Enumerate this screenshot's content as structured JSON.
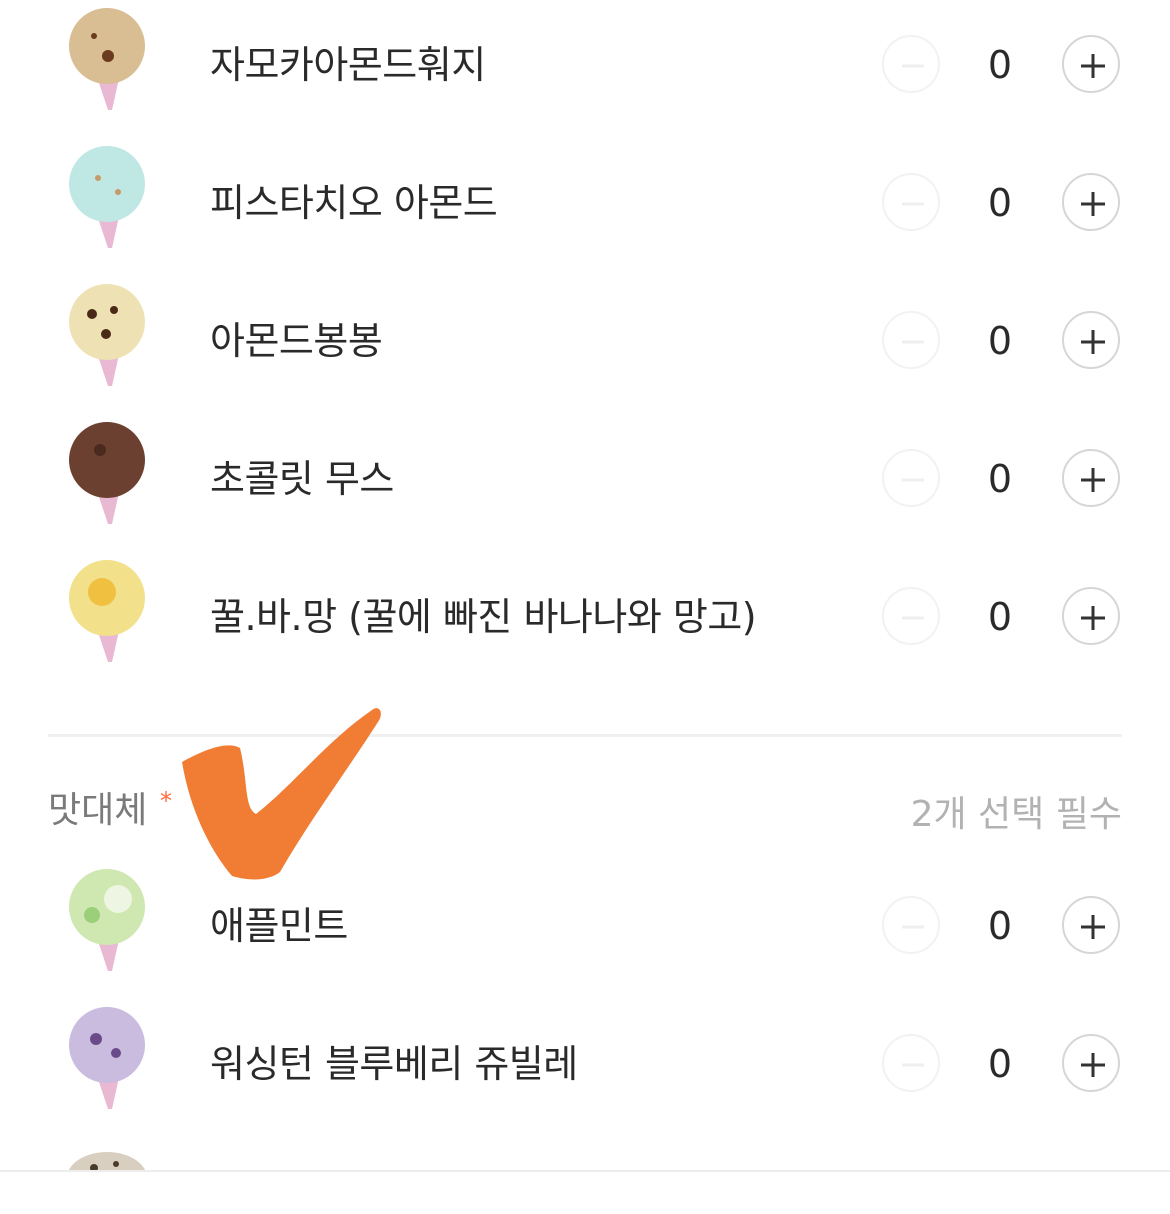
{
  "items_group_1": [
    {
      "name": "자모카아몬드훠지",
      "quantity": "0",
      "scoop_color": "#d9bd93",
      "topping_color": "#6b3b1f"
    },
    {
      "name": "피스타치오 아몬드",
      "quantity": "0",
      "scoop_color": "#bfe7e4",
      "topping_color": "#c89a6a"
    },
    {
      "name": "아몬드봉봉",
      "quantity": "0",
      "scoop_color": "#eee2b4",
      "topping_color": "#4a2a16"
    },
    {
      "name": "초콜릿 무스",
      "quantity": "0",
      "scoop_color": "#6b4030",
      "topping_color": "#4a2a1e"
    },
    {
      "name": "꿀.바.망 (꿀에 빠진 바나나와 망고)",
      "quantity": "0",
      "scoop_color": "#f3e08a",
      "topping_color": "#f0c040"
    }
  ],
  "section": {
    "title": "맛대체",
    "required_mark": "*",
    "hint": "2개 선택 필수"
  },
  "items_group_2": [
    {
      "name": "애플민트",
      "quantity": "0",
      "scoop_color": "#cfe7b0",
      "topping_color": "#9bcf7a"
    },
    {
      "name": "워싱턴 블루베리 쥬빌레",
      "quantity": "0",
      "scoop_color": "#c9bcdf",
      "topping_color": "#6b4a8a"
    }
  ],
  "colors": {
    "annotation_check": "#f0782c",
    "required_star": "#ff6a3d",
    "cone": "#e9b8d2"
  }
}
